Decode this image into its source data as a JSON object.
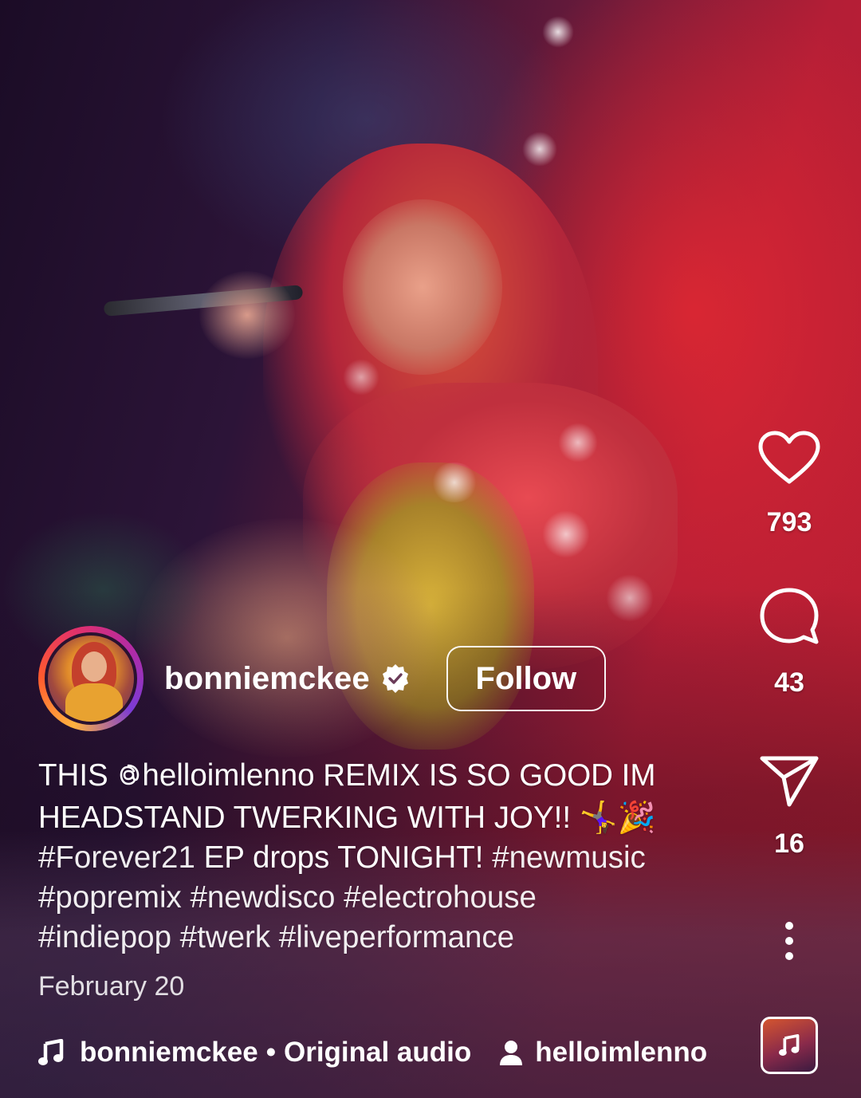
{
  "post": {
    "username": "bonniemckee",
    "verified": true,
    "follow_label": "Follow",
    "caption": {
      "line1_pre": "THIS ",
      "mention": "helloimlenno",
      "line1_post": " REMIX IS SO GOOD IM",
      "line2": "HEADSTAND TWERKING WITH JOY!! 🤸‍♀️🎉",
      "line3_tag1": "#Forever21",
      "line3_text": " EP drops TONIGHT! ",
      "line3_tag2": "#newmusic",
      "line4": "#popremix #newdisco #electrohouse",
      "line5": "#indiepop #twerk #liveperformance"
    },
    "date": "February 20"
  },
  "actions": {
    "likes": "793",
    "comments": "43",
    "shares": "16"
  },
  "audio": {
    "artist": "bonniemckee",
    "separator": "•",
    "title": "Original audio",
    "collaborator": "helloimlenno"
  },
  "icons": {
    "like": "heart-icon",
    "comment": "comment-icon",
    "share": "send-icon",
    "more": "more-vertical-icon",
    "music": "music-note-icon",
    "person": "person-icon",
    "verified": "verified-badge-icon",
    "mention": "threads-at-icon"
  },
  "colors": {
    "background_accent_red": "#c41e3a",
    "background_deep": "#1a0b1e",
    "text": "#ffffff"
  }
}
